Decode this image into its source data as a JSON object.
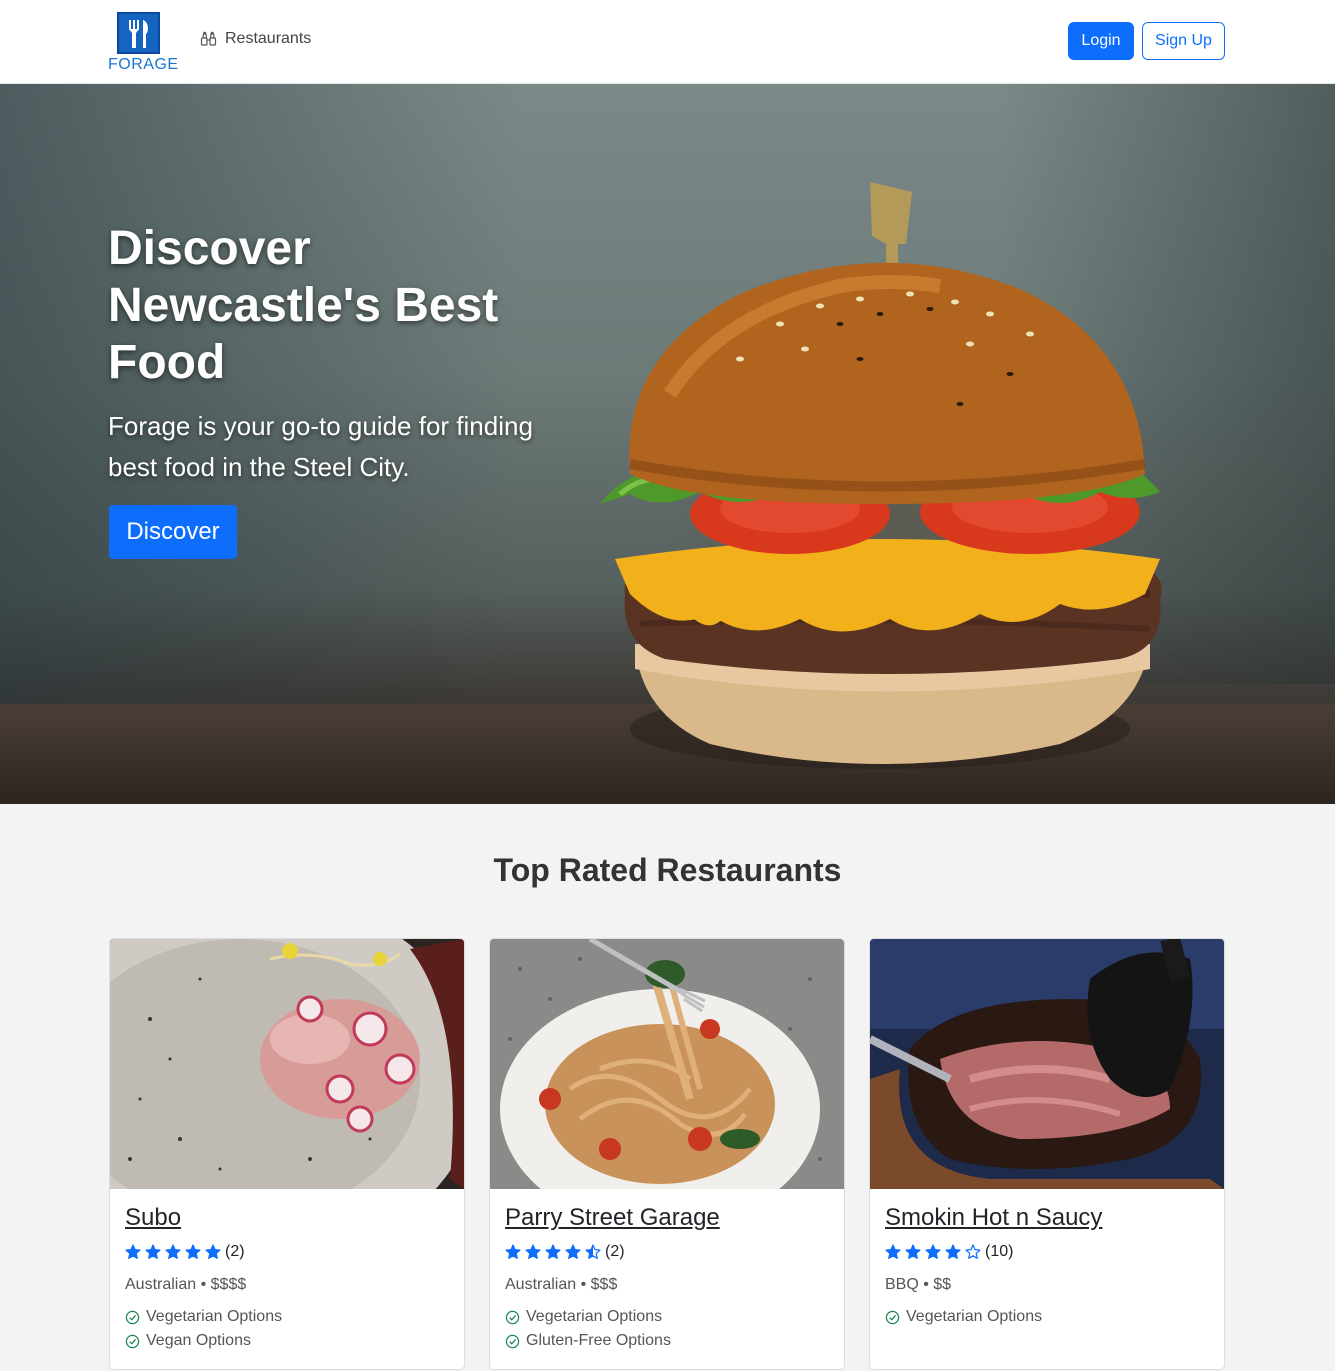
{
  "nav": {
    "brand": "FORAGE",
    "restaurants_link": "Restaurants",
    "login_label": "Login",
    "signup_label": "Sign Up"
  },
  "hero": {
    "title": "Discover Newcastle's Best Food",
    "subtitle": "Forage is your go-to guide for finding best food in the Steel City.",
    "button_label": "Discover"
  },
  "section": {
    "title": "Top Rated Restaurants"
  },
  "colors": {
    "primary": "#0d6efd",
    "star": "#0d6efd",
    "check": "#198754"
  },
  "restaurants": [
    {
      "name": "Subo",
      "rating": 5,
      "review_count": "(2)",
      "meta": "Australian • $$$$",
      "features": [
        "Vegetarian Options",
        "Vegan Options"
      ]
    },
    {
      "name": "Parry Street Garage",
      "rating": 4.5,
      "review_count": "(2)",
      "meta": "Australian • $$$",
      "features": [
        "Vegetarian Options",
        "Gluten-Free Options"
      ]
    },
    {
      "name": "Smokin Hot n Saucy",
      "rating": 4,
      "review_count": "(10)",
      "meta": "BBQ • $$",
      "features": [
        "Vegetarian Options"
      ]
    }
  ]
}
